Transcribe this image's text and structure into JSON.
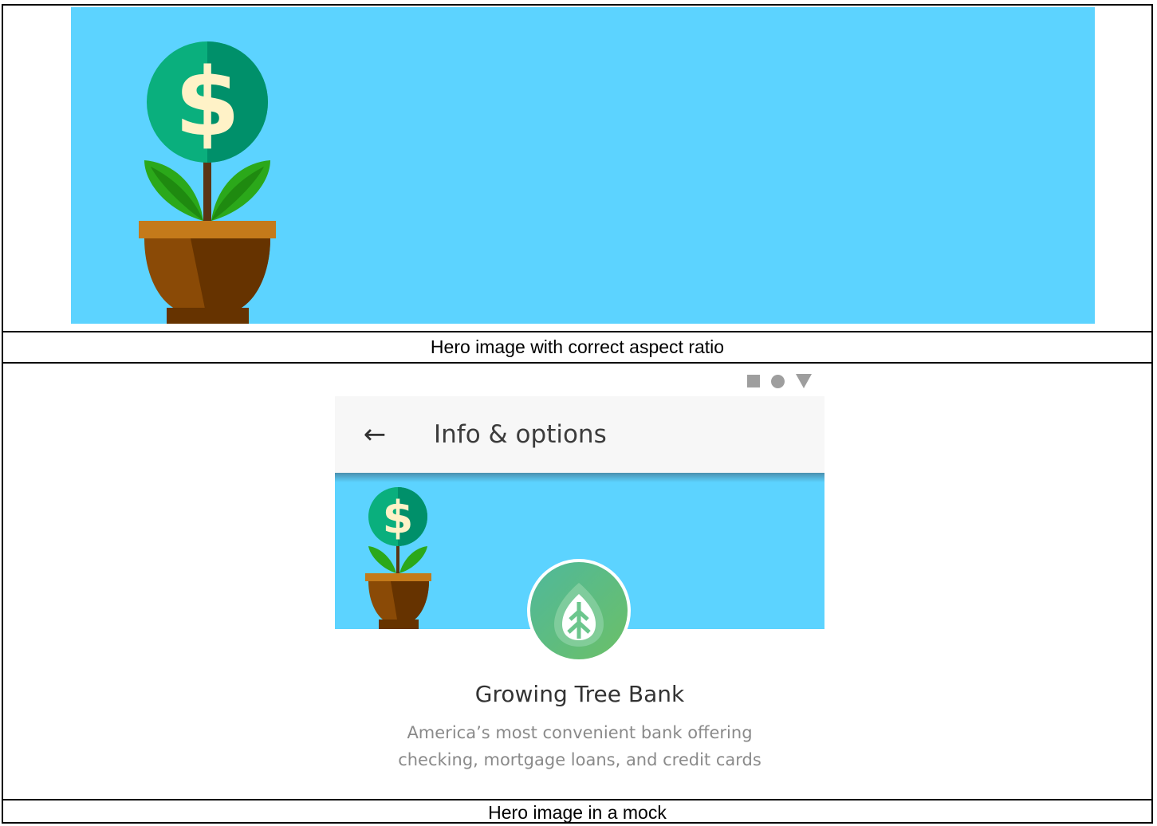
{
  "top_panel": {
    "caption": "Hero image with correct aspect ratio",
    "hero_icon": "money-plant-illustration"
  },
  "mock_panel": {
    "caption": "Hero image in a mock",
    "status_bar_icons": [
      "square-icon",
      "circle-icon",
      "triangle-icon"
    ],
    "app_bar": {
      "back_icon": "arrow-left-icon",
      "back_glyph": "←",
      "title": "Info & options"
    },
    "logo_icon": "leaf-icon",
    "bank_name": "Growing Tree Bank",
    "bank_description_line1": "America’s most convenient bank offering",
    "bank_description_line2": "checking, mortgage loans, and credit cards"
  },
  "colors": {
    "sky": "#5cd3ff",
    "coin_green": "#0aaf7d",
    "coin_dark": "#008c62",
    "dollar": "#fff2c7",
    "leaf": "#2ba81a",
    "pot_rim": "#c47a1a",
    "pot_body": "#8a4a06",
    "pot_dark": "#663300",
    "logo_green": "#5bbd7d"
  }
}
